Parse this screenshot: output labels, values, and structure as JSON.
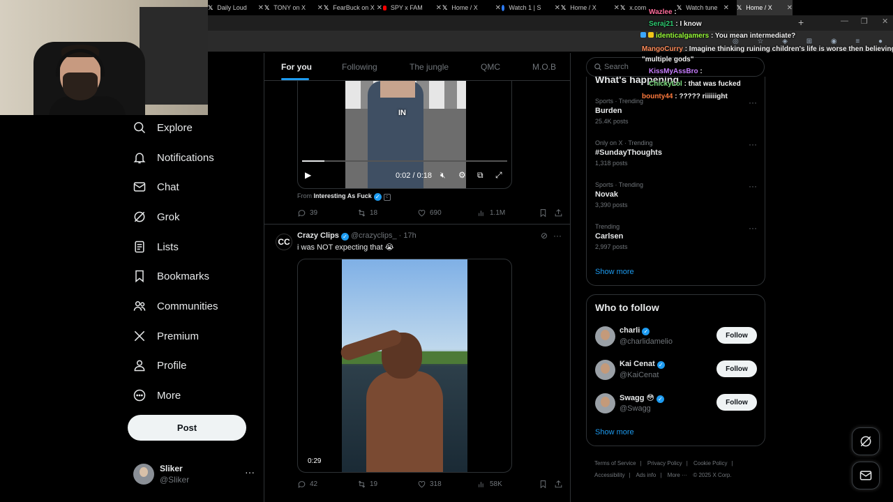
{
  "browser": {
    "tabs": [
      {
        "label": "Daily Loud",
        "icon": "x-icon"
      },
      {
        "label": "TONY on X",
        "icon": "x-icon"
      },
      {
        "label": "FearBuck on X",
        "icon": "x-icon"
      },
      {
        "label": "SPY x FAM",
        "icon": "youtube-icon"
      },
      {
        "label": "Home / X",
        "icon": "x-icon"
      },
      {
        "label": "Watch 1 | S",
        "icon": "globe-icon"
      },
      {
        "label": "Home / X",
        "icon": "x-icon"
      },
      {
        "label": "x.com",
        "icon": "x-icon"
      },
      {
        "label": "Watch tune",
        "icon": "x-icon"
      },
      {
        "label": "Home / X",
        "icon": "x-icon",
        "active": true
      }
    ],
    "new_tab": "+"
  },
  "nav": {
    "items": [
      {
        "label": "Explore",
        "icon": "search-icon"
      },
      {
        "label": "Notifications",
        "icon": "bell-icon"
      },
      {
        "label": "Chat",
        "icon": "mail-icon"
      },
      {
        "label": "Grok",
        "icon": "grok-icon"
      },
      {
        "label": "Lists",
        "icon": "list-icon"
      },
      {
        "label": "Bookmarks",
        "icon": "bookmark-icon"
      },
      {
        "label": "Communities",
        "icon": "people-icon"
      },
      {
        "label": "Premium",
        "icon": "x-logo-icon"
      },
      {
        "label": "Profile",
        "icon": "person-icon"
      },
      {
        "label": "More",
        "icon": "more-circle-icon"
      }
    ],
    "post_label": "Post",
    "account": {
      "name": "Sliker",
      "handle": "@Sliker",
      "more": "···"
    }
  },
  "feed": {
    "tabs": [
      "For you",
      "Following",
      "The jungle",
      "QMC",
      "M.O.B"
    ],
    "active_tab": "For you",
    "tweet1": {
      "video_caption": "IN",
      "progress": 0.11,
      "time": "0:02 / 0:18",
      "from_prefix": "From",
      "from_source": "Interesting As Fuck",
      "stats": {
        "replies": "39",
        "reposts": "18",
        "likes": "690",
        "views": "1.1M"
      }
    },
    "tweet2": {
      "avatar_text": "CC",
      "name": "Crazy Clips",
      "handle_time": "@crazyclips_ · 17h",
      "text": "i was NOT expecting that 😭",
      "duration": "0:29",
      "stats": {
        "replies": "42",
        "reposts": "19",
        "likes": "318",
        "views": "58K"
      }
    }
  },
  "right": {
    "search_placeholder": "Search",
    "trends_title": "What's happening",
    "trends": [
      {
        "meta": "Sports · Trending",
        "name": "Burden",
        "count": "25.4K posts"
      },
      {
        "meta": "Only on X · Trending",
        "name": "#SundayThoughts",
        "count": "1,318 posts"
      },
      {
        "meta": "Sports · Trending",
        "name": "Novak",
        "count": "3,390 posts"
      },
      {
        "meta": "Trending",
        "name": "Carlsen",
        "count": "2,997 posts"
      }
    ],
    "show_more": "Show more",
    "who_to_follow_title": "Who to follow",
    "who_to_follow": [
      {
        "name": "charli",
        "handle": "@charlidamelio",
        "button": "Follow"
      },
      {
        "name": "Kai Cenat",
        "handle": "@KaiCenat",
        "button": "Follow"
      },
      {
        "name": "Swagg 😳",
        "handle": "@Swagg",
        "button": "Follow"
      }
    ],
    "footer": [
      "Terms of Service",
      "|",
      "Privacy Policy",
      "|",
      "Cookie Policy",
      "|",
      "Accessibility",
      "|",
      "Ads info",
      "|",
      "More ···",
      "© 2025 X Corp."
    ]
  },
  "chat": [
    {
      "user": "Wazlee",
      "color": "#ff6b9a",
      "message": ":"
    },
    {
      "user": "Seraj21",
      "color": "#2ecc71",
      "message": ": I know"
    },
    {
      "user": "identicalgamers",
      "color": "#9bff3a",
      "message": ": You mean intermediate?"
    },
    {
      "user": "MangoCurry",
      "color": "#ff8c5a",
      "message": ": Imagine thinking ruining children's life is worse then believing in"
    },
    {
      "user": "",
      "color": "#ffffff",
      "message": "\"multiple gods\""
    },
    {
      "user": "KissMyAssBro",
      "color": "#c77dff",
      "message": ":"
    },
    {
      "user": "ChickyLol",
      "color": "#7ee081",
      "message": ": that was fucked"
    },
    {
      "user": "bounty44",
      "color": "#ff7a3d",
      "message": ": ????? riiiiiight"
    }
  ],
  "colors": {
    "accent": "#1d9bf0",
    "background": "#000000",
    "text": "#e7e9ea",
    "muted": "#71767b"
  }
}
